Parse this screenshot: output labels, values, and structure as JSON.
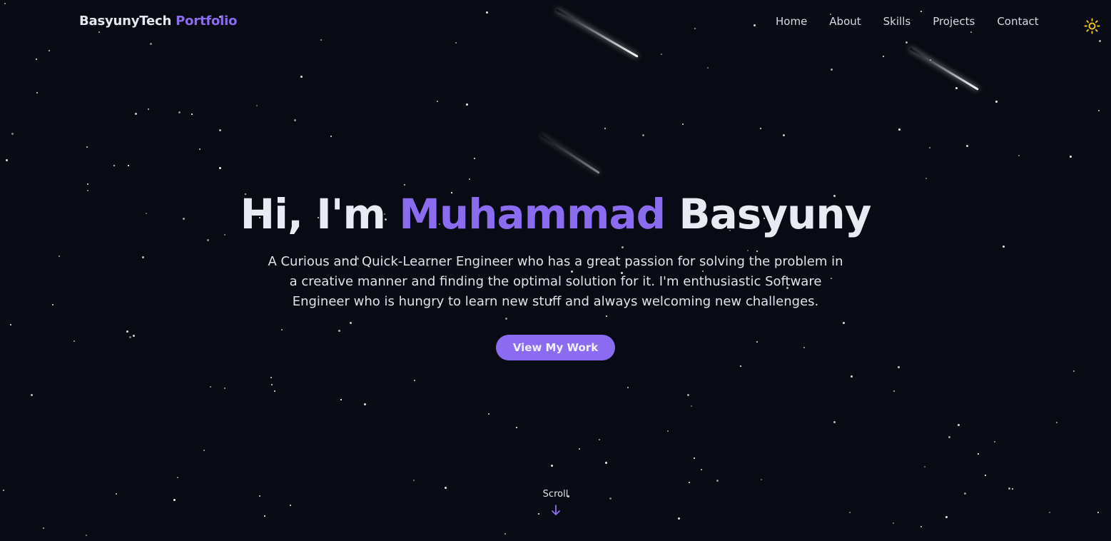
{
  "brand": {
    "name": "BasyunyTech",
    "accent": "Portfolio"
  },
  "nav": {
    "items": [
      {
        "label": "Home"
      },
      {
        "label": "About"
      },
      {
        "label": "Skills"
      },
      {
        "label": "Projects"
      },
      {
        "label": "Contact"
      }
    ]
  },
  "theme_toggle": {
    "icon": "sun-icon",
    "color": "#f5c518"
  },
  "hero": {
    "greeting": "Hi, I'm",
    "first_name": "Muhammad",
    "last_name": "Basyuny",
    "description": "A Curious and Quick-Learner Engineer who has a great passion for solving the problem in a creative manner and finding the optimal solution for it. I'm enthusiastic Software Engineer who is hungry to learn new stuff and always welcoming new challenges.",
    "cta_label": "View My Work"
  },
  "scroll": {
    "label": "Scroll",
    "icon": "arrow-down-icon"
  },
  "colors": {
    "background": "#080b13",
    "accent": "#8b6cf0",
    "text": "#e5e8f0"
  }
}
